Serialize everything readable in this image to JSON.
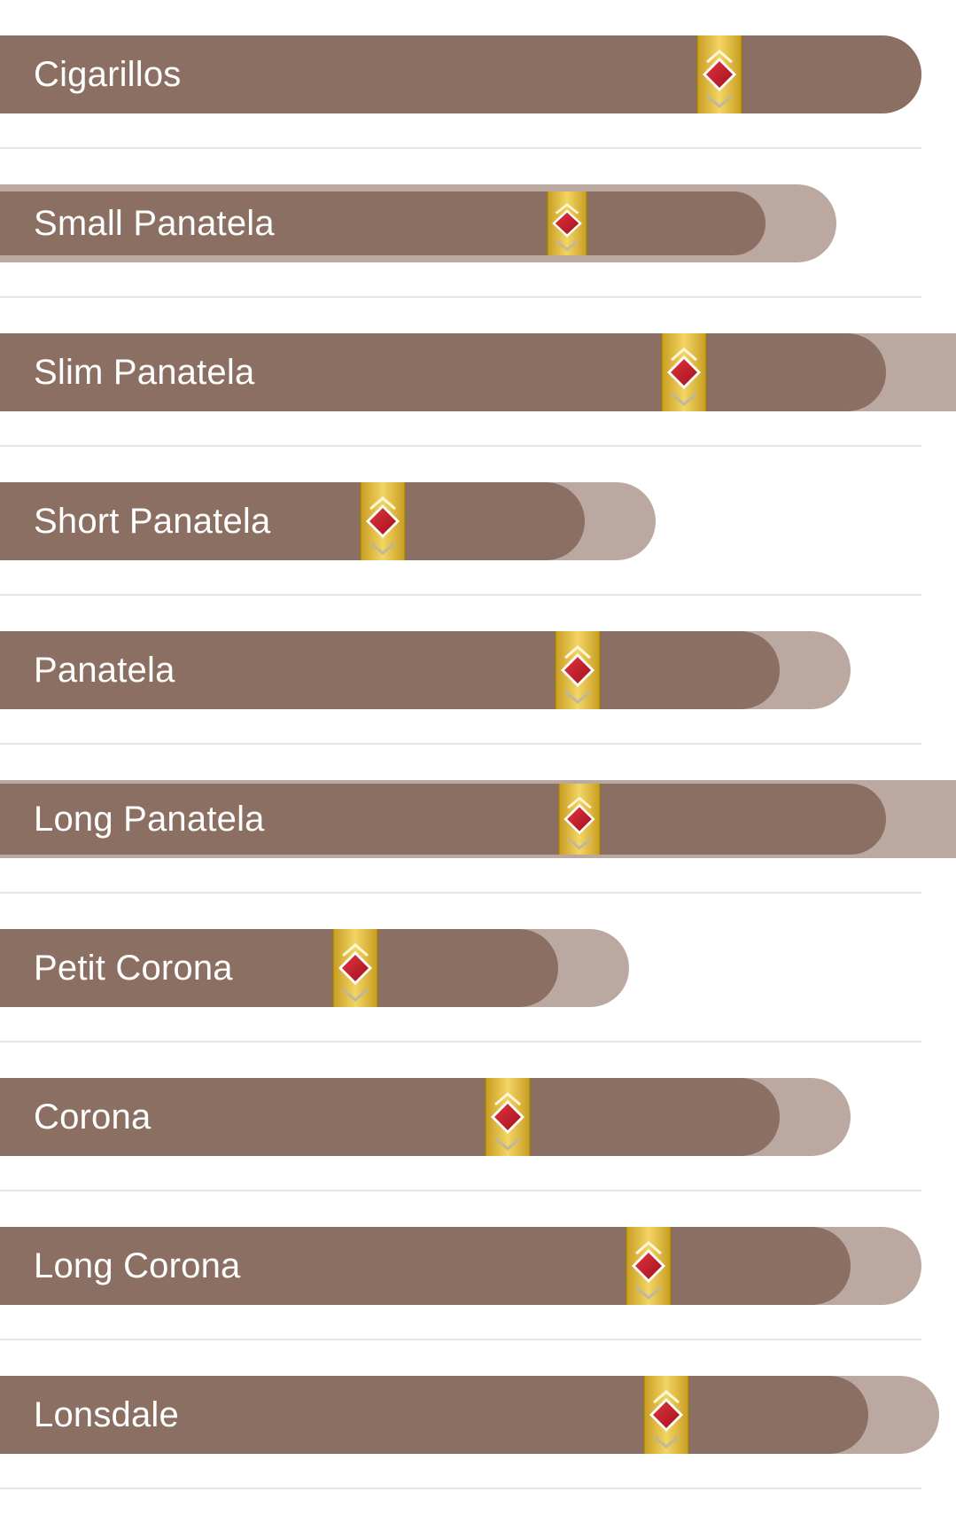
{
  "colors": {
    "cigar_body": "#8b6f62",
    "cigar_outline": "#bba8a0",
    "band_gold": "#e2bd3c",
    "band_jewel": "#c41f2c",
    "divider": "#e4e4e4",
    "label_text": "#ffffff"
  },
  "cigar_sizes": [
    {
      "label": "Cigarillos",
      "band_icon": "gold-band-diamond-icon"
    },
    {
      "label": "Small Panatela",
      "band_icon": "gold-band-diamond-icon"
    },
    {
      "label": "Slim Panatela",
      "band_icon": "gold-band-diamond-icon"
    },
    {
      "label": "Short Panatela",
      "band_icon": "gold-band-diamond-icon"
    },
    {
      "label": "Panatela",
      "band_icon": "gold-band-diamond-icon"
    },
    {
      "label": "Long Panatela",
      "band_icon": "gold-band-diamond-icon"
    },
    {
      "label": "Petit Corona",
      "band_icon": "gold-band-diamond-icon"
    },
    {
      "label": "Corona",
      "band_icon": "gold-band-diamond-icon"
    },
    {
      "label": "Long Corona",
      "band_icon": "gold-band-diamond-icon"
    },
    {
      "label": "Lonsdale",
      "band_icon": "gold-band-diamond-icon"
    }
  ]
}
